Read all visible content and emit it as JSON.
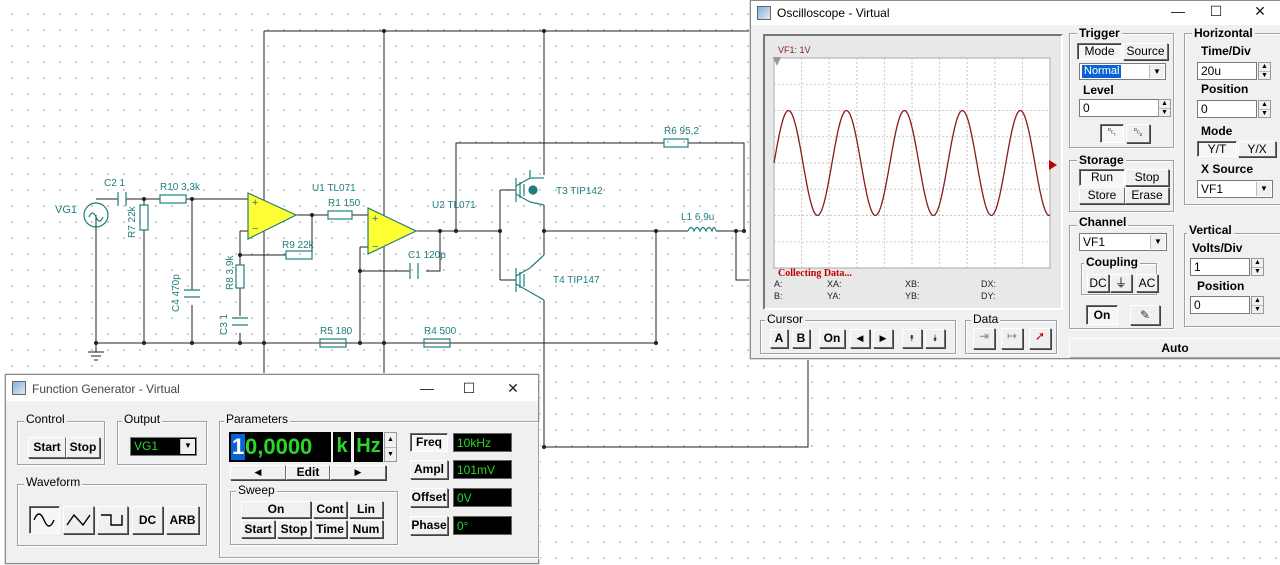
{
  "schematic": {
    "labels": {
      "vg1": "VG1",
      "c2": "C2 1",
      "r10": "R10 3,3k",
      "r7": "R7 22k",
      "c4": "C4 470p",
      "u1": "U1 TL071",
      "r1": "R1 150",
      "r9": "R9 22k",
      "r8": "R8 3,9k",
      "c3": "C3 1",
      "u2": "U2 TL071",
      "c1": "C1 120p",
      "r5": "R5 180",
      "r4": "R4 500",
      "t3": "T3 TIP142",
      "t4": "T4 TIP147",
      "r6": "R6 95,2",
      "l1": "L1 6,9u"
    }
  },
  "oscilloscope": {
    "title": "Oscilloscope - Virtual",
    "trace_label": "VF1: 1V",
    "status": "Collecting Data...",
    "cursor_readouts": [
      "A:",
      "XA:",
      "XB:",
      "DX:",
      "B:",
      "YA:",
      "YB:",
      "DY:"
    ],
    "trigger": {
      "title": "Trigger",
      "mode_btn": "Mode",
      "source_btn": "Source",
      "mode_value": "Normal",
      "level_label": "Level",
      "level_value": "0"
    },
    "horizontal": {
      "title": "Horizontal",
      "timediv_label": "Time/Div",
      "timediv_value": "20u",
      "position_label": "Position",
      "position_value": "0",
      "mode_label": "Mode",
      "yt": "Y/T",
      "yx": "Y/X",
      "xsource_label": "X Source",
      "xsource_value": "VF1"
    },
    "storage": {
      "title": "Storage",
      "run": "Run",
      "stop": "Stop",
      "store": "Store",
      "erase": "Erase"
    },
    "channel": {
      "title": "Channel",
      "value": "VF1",
      "coupling_title": "Coupling",
      "dc": "DC",
      "gnd": "⏚",
      "ac": "AC",
      "on": "On"
    },
    "vertical": {
      "title": "Vertical",
      "voltsdiv_label": "Volts/Div",
      "voltsdiv_value": "1",
      "position_label": "Position",
      "position_value": "0"
    },
    "cursor": {
      "title": "Cursor",
      "a": "A",
      "b": "B",
      "on": "On",
      "left": "◀",
      "right": "▶",
      "up": "⯭",
      "down": "⯯"
    },
    "data_title": "Data",
    "auto": "Auto",
    "waveform": {
      "type": "sine",
      "amplitude_div": 2,
      "period_div": 2.1,
      "phase_deg": 0
    }
  },
  "function_generator": {
    "title": "Function Generator - Virtual",
    "control_title": "Control",
    "start": "Start",
    "stop": "Stop",
    "output_title": "Output",
    "output_value": "VG1",
    "waveform_title": "Waveform",
    "dc": "DC",
    "arb": "ARB",
    "parameters_title": "Parameters",
    "display_first": "1",
    "display_rest": "0,0000",
    "display_prefix": "k",
    "display_unit": "Hz",
    "edit": "Edit",
    "sweep_title": "Sweep",
    "sweep_on": "On",
    "sweep_cont": "Cont",
    "sweep_lin": "Lin",
    "sweep_start": "Start",
    "sweep_stop": "Stop",
    "sweep_time": "Time",
    "sweep_num": "Num",
    "params": [
      {
        "label": "Freq",
        "value": "10kHz"
      },
      {
        "label": "Ampl",
        "value": "101mV"
      },
      {
        "label": "Offset",
        "value": "0V"
      },
      {
        "label": "Phase",
        "value": "0°"
      }
    ]
  },
  "colors": {
    "wire": "#222222",
    "component": "#1f7e7e",
    "opamp_fill": "#ffff33",
    "trace": "#8b1a1a",
    "lcd_text": "#28d728"
  }
}
